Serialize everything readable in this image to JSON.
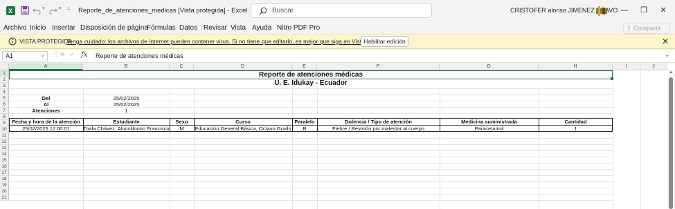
{
  "titlebar": {
    "document_title": "Reporte_de_atenciones_medicas  [Vista protegida]  -  Excel",
    "search_placeholder": "Buscar",
    "user_name": "CRISTOFER alonso JIMENEZ BRAVO",
    "minimize": "—",
    "restore": "❐",
    "close": "✕"
  },
  "menu": {
    "items": [
      "Archivo",
      "Inicio",
      "Insertar",
      "Disposición de página",
      "Fórmulas",
      "Datos",
      "Revisar",
      "Vista",
      "Ayuda",
      "Nitro PDF Pro"
    ],
    "share": "Compartir"
  },
  "protected_view": {
    "label": "VISTA PROTEGIDA",
    "message": "Tenga cuidado: los archivos de Internet pueden contener virus. Si no tiene que editarlo, es mejor que siga en Vista protegida.",
    "button": "Habilitar edición"
  },
  "formula_bar": {
    "name_box": "A1",
    "fx": "fx",
    "content": "Reporte de atenciones médicas"
  },
  "sheet": {
    "columns": [
      "A",
      "B",
      "C",
      "D",
      "E",
      "F",
      "G",
      "H",
      "I",
      "J"
    ],
    "rows": [
      "1",
      "2",
      "3",
      "4",
      "5",
      "6",
      "7",
      "8",
      "9",
      "10",
      "11",
      "12",
      "13",
      "14",
      "15",
      "16",
      "17",
      "18",
      "19",
      "20",
      "21"
    ],
    "title": "Reporte de atenciones médicas",
    "subtitle": "U. E. Idukay - Ecuador",
    "summary": {
      "del_label": "Del",
      "del_value": "25/02/2025",
      "al_label": "Al",
      "al_value": "25/02/2025",
      "atenciones_label": "Atenciones",
      "atenciones_value": "1"
    },
    "table_headers": [
      "Fecha y hora de la atención",
      "Estudiante",
      "Sexo",
      "Curso",
      "Paralelo",
      "Dolencia / Tipo de atención",
      "Medicina suministrada",
      "Cantidad"
    ],
    "table_rows": [
      [
        "25/02/2025 12:00:01",
        "Toala Chávez, Alonsilloooo Francisco",
        "M",
        "Educación General Básica, Octavo Grado",
        "B",
        "Fiebre / Revisión por malestar al cuerpo",
        "Paracetamol",
        "1"
      ]
    ]
  },
  "colors": {
    "excel_green": "#217346",
    "protected_bar": "#fff4ce"
  }
}
